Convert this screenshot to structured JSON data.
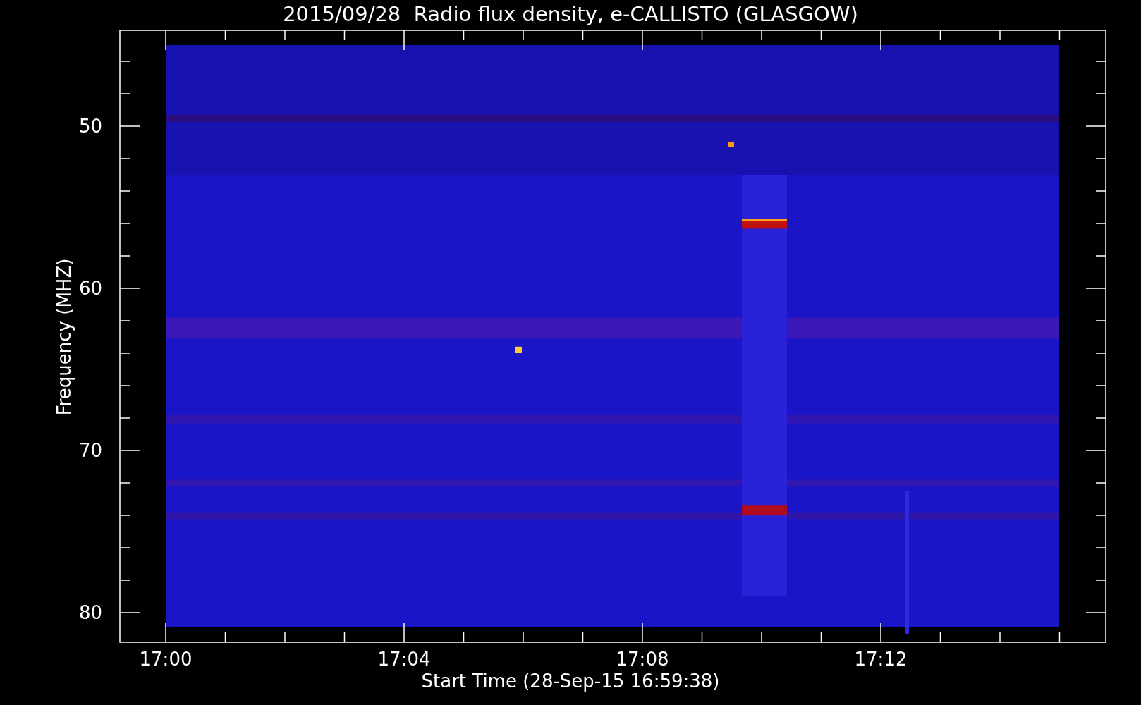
{
  "title": "2015/09/28  Radio flux density, e-CALLISTO (GLASGOW)",
  "y_axis": {
    "label": "Frequency (MHZ)",
    "ticks": [
      "50",
      "60",
      "70",
      "80"
    ]
  },
  "x_axis": {
    "label": "Start Time (28-Sep-15 16:59:38)",
    "ticks": [
      "17:00",
      "17:04",
      "17:08",
      "17:12"
    ]
  }
}
